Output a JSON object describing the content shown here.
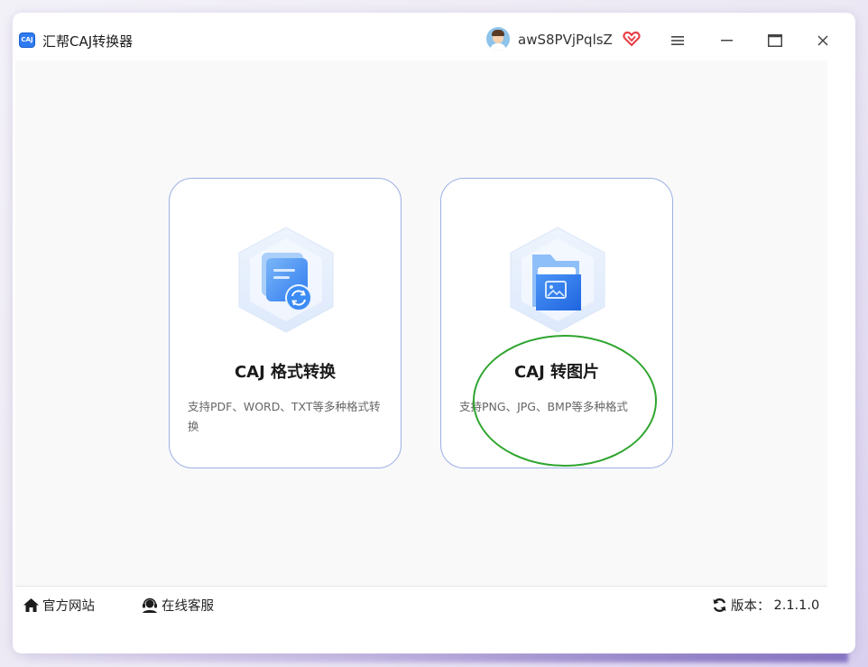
{
  "window": {
    "app_logo_text": "CAJ",
    "title": "汇帮CAJ转换器",
    "username": "awS8PVjPqlsZ",
    "accent_color": "#2f7bf0",
    "vip_color": "#e8424a"
  },
  "cards": [
    {
      "title": "CAJ 格式转换",
      "description": "支持PDF、WORD、TXT等多种格式转换",
      "icon": "document-convert-icon"
    },
    {
      "title": "CAJ 转图片",
      "description": "支持PNG、JPG、BMP等多种格式",
      "icon": "image-folder-icon"
    }
  ],
  "footer": {
    "official_site": "官方网站",
    "online_service": "在线客服",
    "version_label": "版本：",
    "version_value": "2.1.1.0"
  },
  "annotation": {
    "highlight_color": "#2fa52f"
  }
}
